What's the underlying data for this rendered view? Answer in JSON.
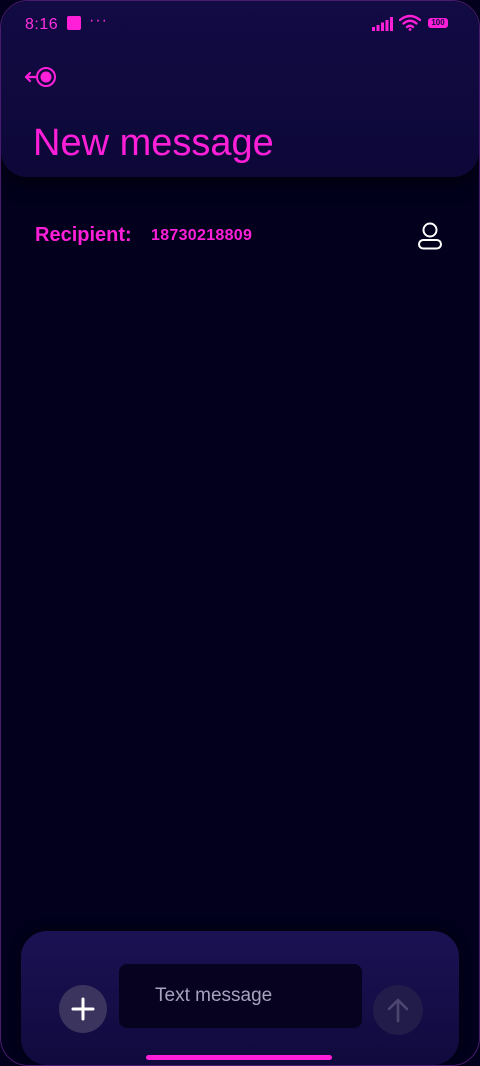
{
  "status_bar": {
    "time": "8:16",
    "more": "···",
    "battery": "100"
  },
  "header": {
    "title": "New message",
    "back_icon": "back-arrow-circle-icon"
  },
  "recipient": {
    "label": "Recipient:",
    "value": "18730218809",
    "contact_icon": "person-icon"
  },
  "composer": {
    "placeholder": "Text message",
    "attach_icon": "plus-icon",
    "send_icon": "arrow-up-icon"
  },
  "colors": {
    "accent": "#ff1fd9",
    "background": "#02001c",
    "header": "#120b44"
  }
}
